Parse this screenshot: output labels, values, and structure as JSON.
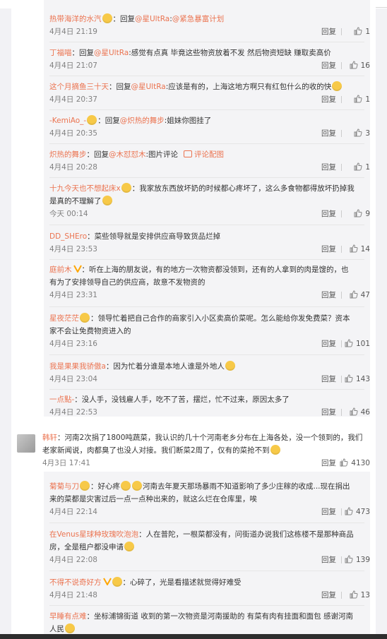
{
  "ui": {
    "reply_label": "回复",
    "view_comment_image_label": "评论配图"
  },
  "sub_replies_a": [
    {
      "user": "热带海洋的水汽",
      "badge": "member",
      "text_prefix": "：回复",
      "mentions": [
        "@星UltRa",
        "@紧急暴富计划"
      ],
      "text": "",
      "time": "4月4日 21:19",
      "likes": "1"
    },
    {
      "user": "丁福喵",
      "badge": "",
      "text_prefix": "：回复",
      "mentions": [
        "@星UltRa"
      ],
      "text": ":感觉有点真 毕竟这些物资放着不发 然后物资短缺 赚取卖高价",
      "time": "4月4日 21:07",
      "likes": "16"
    },
    {
      "user": "这个月摘鱼三十天",
      "badge": "",
      "text_prefix": "：回复",
      "mentions": [
        "@星UltRa"
      ],
      "text": ":应该是有的，上海这地方啊只有红包什么的收的快",
      "emoji": true,
      "time": "4月4日 20:37",
      "likes": "1"
    },
    {
      "user": "-KemiAo_-",
      "badge": "member",
      "text_prefix": "：回复",
      "mentions": [
        "@炽热的舞步"
      ],
      "text": ":姐妹你图挂了",
      "time": "4月4日 20:35",
      "likes": "3"
    },
    {
      "user": "炽热的舞步",
      "badge": "",
      "text_prefix": "：回复",
      "mentions": [
        "@木怼怼木"
      ],
      "text": ":图片评论",
      "time": "4月4日 20:28",
      "likes": "1"
    }
  ],
  "sub_replies_b": [
    {
      "user": "十九今天也不想起床x",
      "line1": "：我家放东西放坏奶的时候都心疼坏了，这么多食物都得放坏扔掉我",
      "line2": "是真的不理解了",
      "time": "今天 00:14",
      "likes": "9"
    },
    {
      "user": "DD_SHEro",
      "line1": "：菜些领导就是安排供应商导致货品烂掉",
      "time": "4月4日 23:53",
      "likes": "14"
    },
    {
      "user": "庭前木",
      "line1": "：听在上海的朋友说，有的地方一次物资都没领到，还有的人拿到的肉是馊的，也",
      "line2": "有为了安排领导自己的供应商，故意不发物资的",
      "time": "4月4日 23:31",
      "likes": "47"
    },
    {
      "user": "星夜茫茫",
      "line1": "：领导忙着把自己合作的商家引入小区卖高价菜呢。怎么能给你发免费菜？资本",
      "line2": "家不会让免费物资进入的",
      "time": "4月4日 23:16",
      "likes": "101"
    },
    {
      "user": "我是果果我骄傲a",
      "line1": "：因为忙着分谁是本地人谁是外地人",
      "time": "4月4日 23:04",
      "likes": "143"
    },
    {
      "user": "一点點-",
      "line1": "：没人手，没钱雇人手，吃不了苦，摆烂，忙不过来，原因太多了",
      "time": "4月4日 22:53",
      "likes": "46"
    }
  ],
  "main_comment": {
    "user": "韩轩",
    "line1": "：河南2次捐了1800吨蔬菜，我认识的几十个河南老乡分布在上海各处，没一个领到的，我们",
    "line2": "老家新闻说，肉都臭了也没人对接。我们断菜2周了，仅有的菜抢不到",
    "time": "4月3日 17:41",
    "likes": "4130"
  },
  "sub_replies_c": [
    {
      "user": "菊菊与刀",
      "line1": "：好心疼",
      "line1b": "河南去年夏天那场暴雨不知道影响了多少庄稼的收成...现在捐出",
      "line2": "来的菜都是灾害过后一点一点种出来的，就这么烂在仓库里，唉",
      "time": "4月4日 22:14",
      "likes": "473"
    },
    {
      "user": "在Venus星球种玫瑰吹泡泡",
      "line1": "：人在普陀，一根菜都没有，问街道办说我们这栋楼不是那种商品",
      "line2": "房，全是租户都没申请",
      "time": "4月4日 22:08",
      "likes": "139"
    },
    {
      "user": "不得不说奇好方",
      "line1": "：心碎了，光是看描述就觉得好难受",
      "time": "4月4日 21:48",
      "likes": "13"
    },
    {
      "user": "早睡有点难",
      "line1": "：坐标浦锦街道 收到的第一次物资是河南援助的 有菜有肉有挂面和面包 感谢河南",
      "line2": "人民",
      "time": "",
      "likes": ""
    }
  ]
}
